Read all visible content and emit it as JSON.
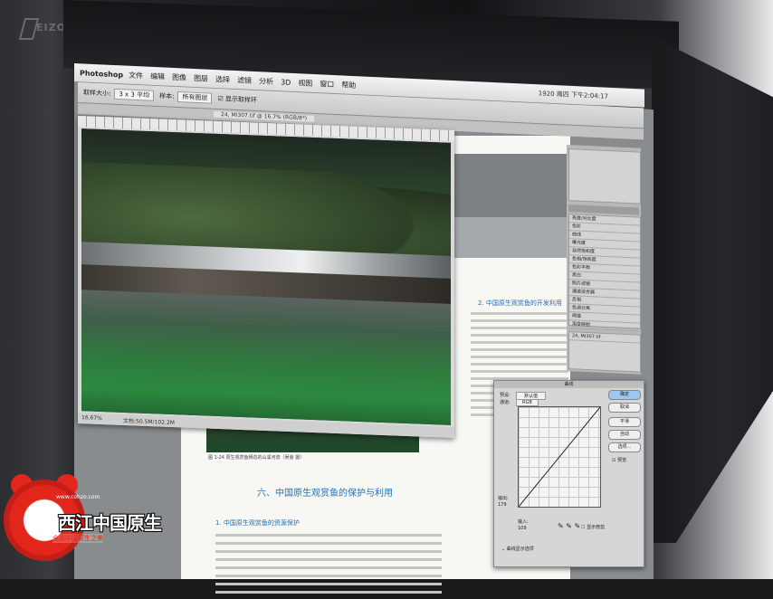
{
  "brand": {
    "monitor_logo": "EIZO"
  },
  "menubar": {
    "app": "Photoshop",
    "items": [
      "文件",
      "编辑",
      "图像",
      "图层",
      "选择",
      "滤镜",
      "分析",
      "3D",
      "视图",
      "窗口",
      "帮助"
    ],
    "clock": "1920 周四 下午2:04:17"
  },
  "options": {
    "sample_label": "取样大小:",
    "sample_value": "3 x 3 平均",
    "style_label": "样本:",
    "style_value": "所有图层",
    "ring_label": "显示取样环"
  },
  "document_tab": {
    "title": "24, MI307.tif @ 16.7% (RGB/8*)"
  },
  "image_window": {
    "zoom": "16.67%",
    "doc_size": "文档:50.5M/102.2M"
  },
  "page": {
    "section_heading": "六、中国原生观赏鱼的保护与利用",
    "subheading_1": "1. 中国原生观赏鱼的资源保护",
    "subheading_2": "2. 中国原生观赏鱼的开发利用",
    "figure_caption": "图 1-24 原生观赏鱼栖息的山溪河流（吴嵩 摄）"
  },
  "panels": {
    "adjust_rows": [
      "亮度/对比度",
      "色阶",
      "曲线",
      "曝光度",
      "自然饱和度",
      "色相/饱和度",
      "色彩平衡",
      "黑白",
      "照片滤镜",
      "通道混合器",
      "反相",
      "色调分离",
      "阈值",
      "渐变映射",
      "可选颜色"
    ],
    "layer_name": "24, MI307.tif"
  },
  "curves_dialog": {
    "title": "曲线",
    "preset_label": "预设:",
    "preset_value": "默认值",
    "channel_label": "通道:",
    "channel_value": "RGB",
    "output_label": "输出:",
    "output_value": "179",
    "input_label": "输入:",
    "input_value": "109",
    "buttons": [
      "确定",
      "取消",
      "平滑",
      "自动",
      "选项..."
    ],
    "preview_label": "预览",
    "clipping_label": "显示修剪",
    "display_label": "曲线显示选项"
  },
  "watermark": {
    "url": "www.cohzo.com",
    "title": "西江中国原生",
    "subtitle": "全国中国原生之美"
  }
}
